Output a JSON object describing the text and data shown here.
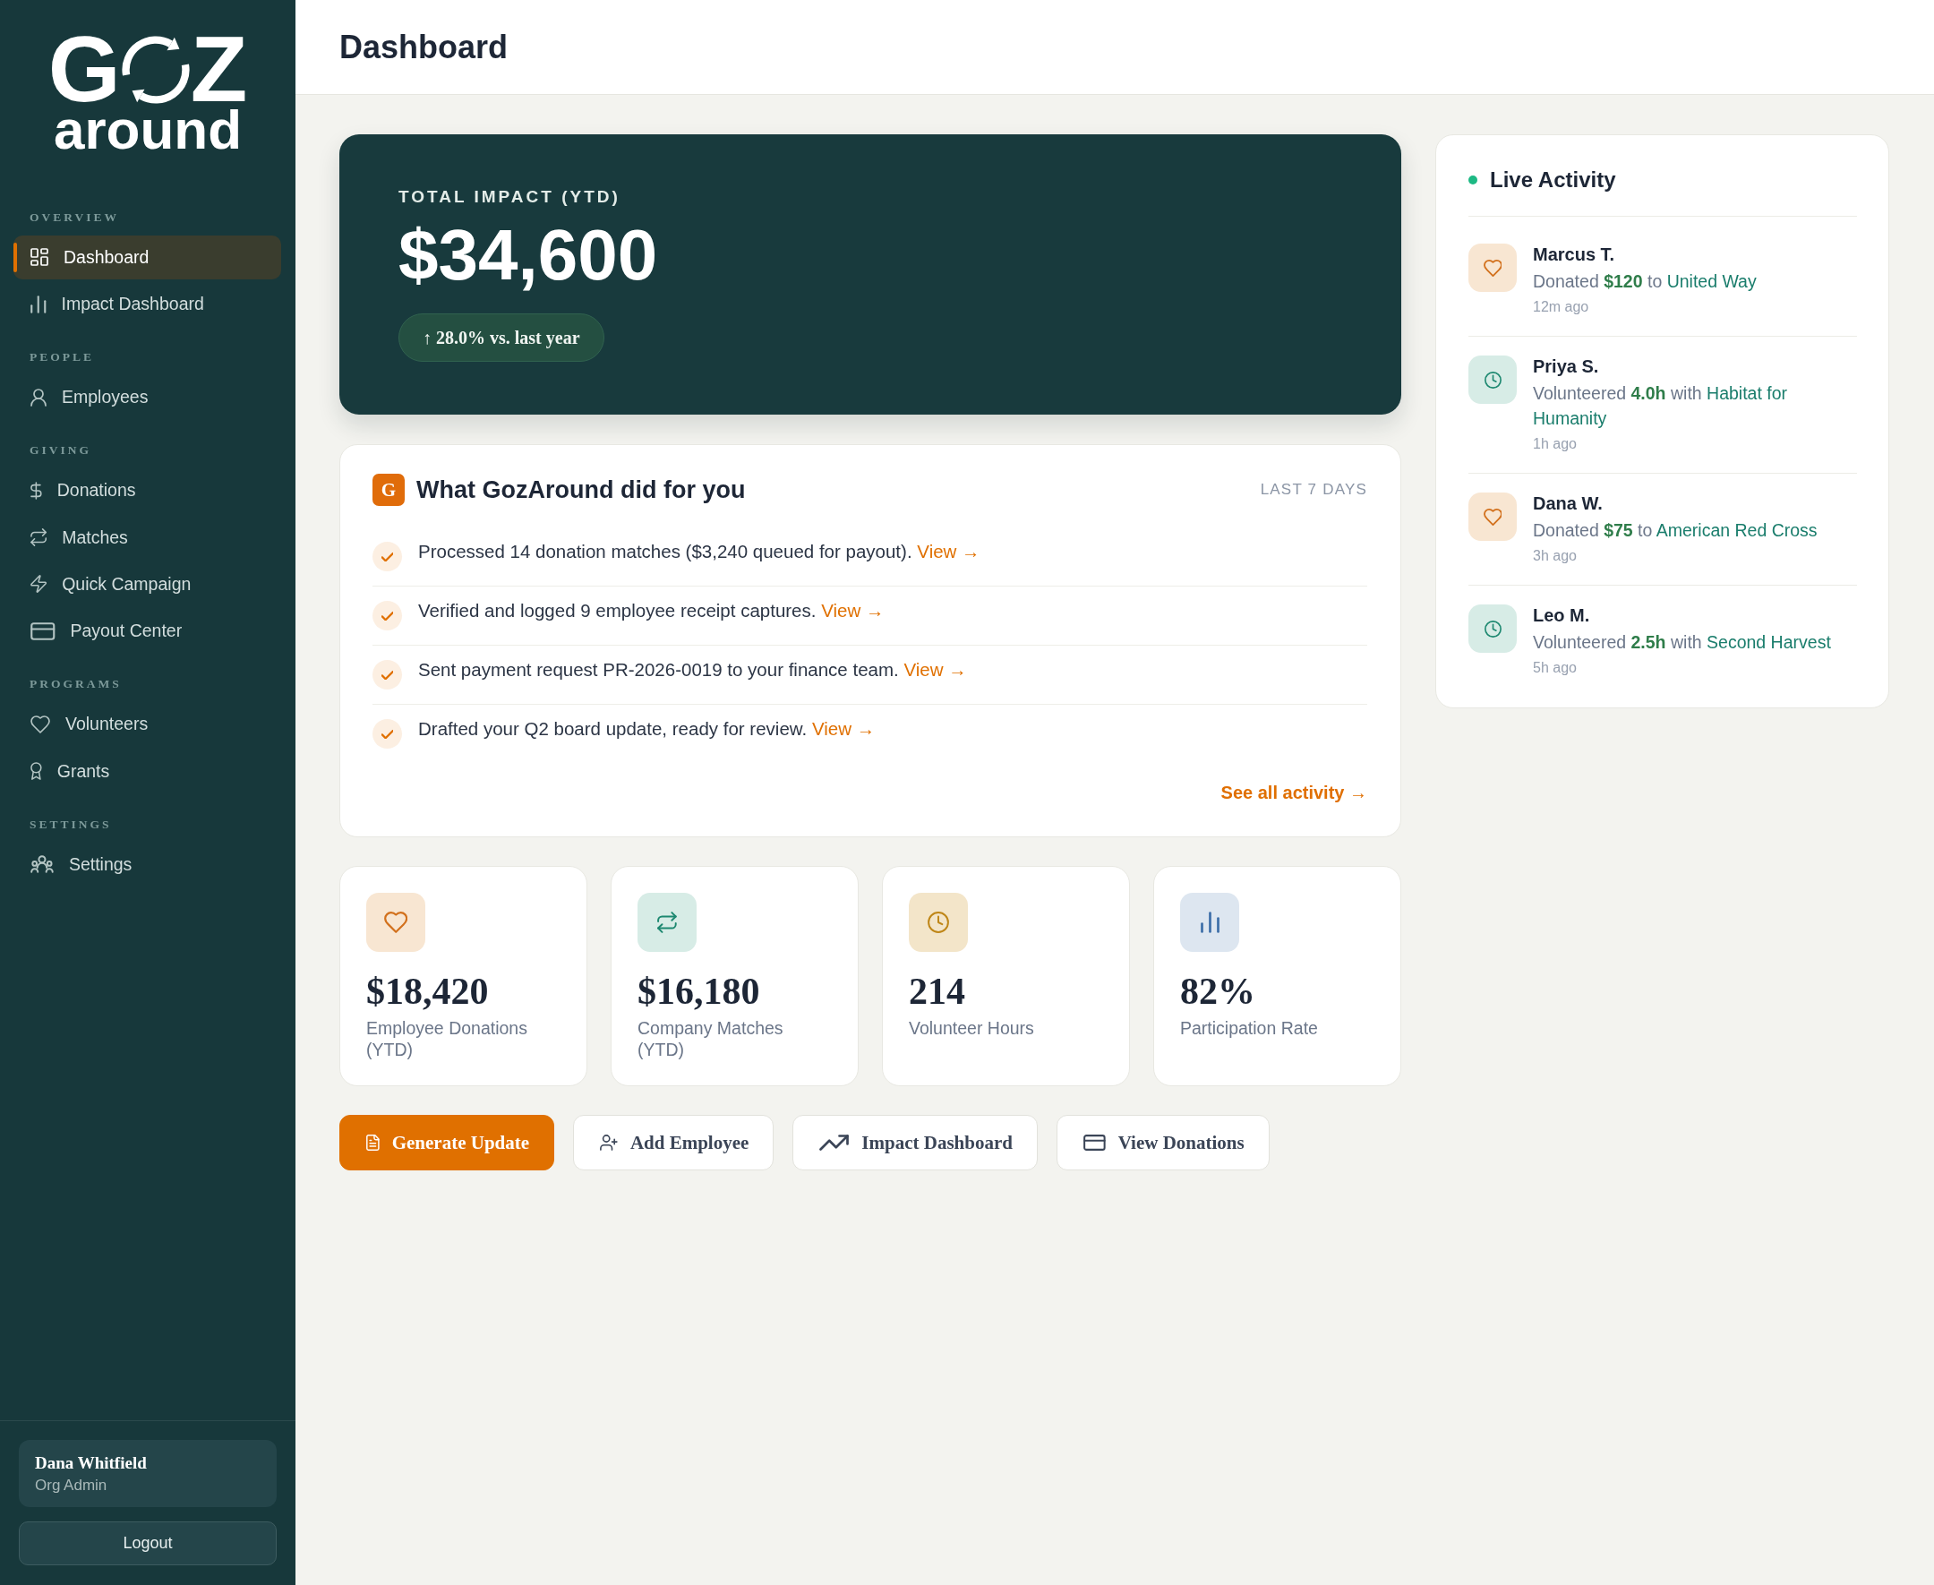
{
  "sidebar": {
    "logo": {
      "letter_left": "G",
      "letter_right": "Z",
      "wordmark": "around"
    },
    "sections": [
      {
        "label": "OVERVIEW",
        "items": [
          {
            "label": "Dashboard",
            "selected": true
          },
          {
            "label": "Impact Dashboard",
            "selected": false
          }
        ]
      },
      {
        "label": "PEOPLE",
        "items": [
          {
            "label": "Employees",
            "selected": false
          }
        ]
      },
      {
        "label": "GIVING",
        "items": [
          {
            "label": "Donations",
            "selected": false
          },
          {
            "label": "Matches",
            "selected": false
          },
          {
            "label": "Quick Campaign",
            "selected": false
          },
          {
            "label": "Payout Center",
            "selected": false
          }
        ]
      },
      {
        "label": "PROGRAMS",
        "items": [
          {
            "label": "Volunteers",
            "selected": false
          },
          {
            "label": "Grants",
            "selected": false
          }
        ]
      },
      {
        "label": "SETTINGS",
        "items": [
          {
            "label": "Settings",
            "selected": false
          }
        ]
      }
    ],
    "user": {
      "name": "Dana Whitfield",
      "role": "Org Admin"
    },
    "logout_button": "Logout"
  },
  "header": {
    "title": "Dashboard"
  },
  "hero": {
    "label": "TOTAL IMPACT (YTD)",
    "value": "$34,600",
    "change": "↑ 28.0% vs. last year"
  },
  "digest": {
    "badge": "G",
    "title": "What GozAround did for you",
    "period": "LAST 7 DAYS",
    "items": [
      {
        "text": "Processed 14 donation matches ($3,240 queued for payout).",
        "link": "View →"
      },
      {
        "text": "Verified and logged 9 employee receipt captures.",
        "link": "View →"
      },
      {
        "text": "Sent payment request PR-2026-0019 to your finance team.",
        "link": "View →"
      },
      {
        "text": "Drafted your Q2 board update, ready for review.",
        "link": "View →"
      }
    ],
    "footer_link": "See all activity →"
  },
  "stats": [
    {
      "kind": "donations",
      "value": "$18,420",
      "label": "Employee Donations (YTD)"
    },
    {
      "kind": "matches",
      "value": "$16,180",
      "label": "Company Matches (YTD)"
    },
    {
      "kind": "hours",
      "value": "214",
      "label": "Volunteer Hours"
    },
    {
      "kind": "rate",
      "value": "82%",
      "label": "Participation Rate"
    }
  ],
  "actions": [
    {
      "kind": "primary",
      "label": "Generate Update"
    },
    {
      "kind": "secondary",
      "label": "Add Employee"
    },
    {
      "kind": "secondary",
      "label": "Impact Dashboard"
    },
    {
      "kind": "secondary",
      "label": "View Donations"
    }
  ],
  "live_activity": {
    "title": "Live Activity",
    "items": [
      {
        "kind": "donation",
        "name": "Marcus T.",
        "verb": "Donated",
        "amount": "$120",
        "connector": "to",
        "organization": "United Way",
        "time": "12m ago"
      },
      {
        "kind": "volunteer",
        "name": "Priya S.",
        "verb": "Volunteered",
        "amount": "4.0h",
        "connector": "with",
        "organization": "Habitat for Humanity",
        "time": "1h ago"
      },
      {
        "kind": "donation",
        "name": "Dana W.",
        "verb": "Donated",
        "amount": "$75",
        "connector": "to",
        "organization": "American Red Cross",
        "time": "3h ago"
      },
      {
        "kind": "volunteer",
        "name": "Leo M.",
        "verb": "Volunteered",
        "amount": "2.5h",
        "connector": "with",
        "organization": "Second Harvest",
        "time": "5h ago"
      }
    ]
  }
}
